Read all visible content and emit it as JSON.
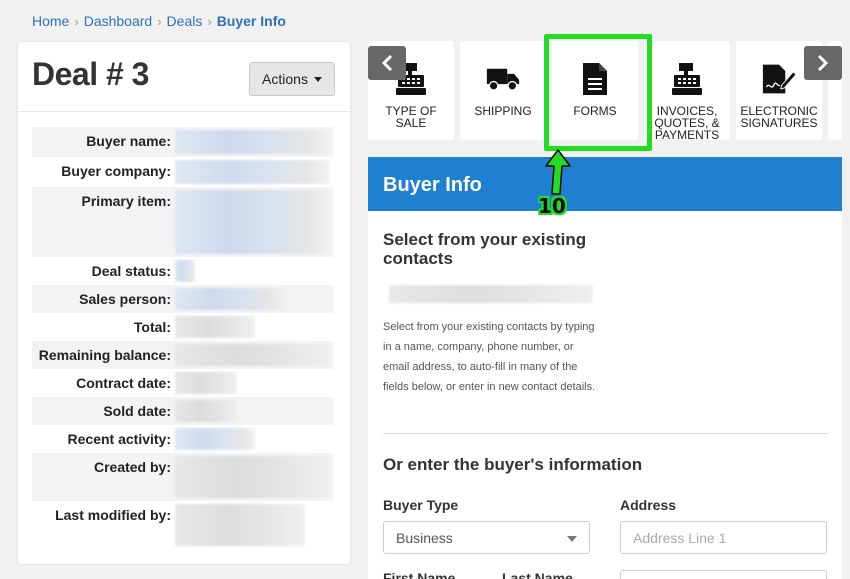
{
  "breadcrumb": {
    "home": "Home",
    "dashboard": "Dashboard",
    "deals": "Deals",
    "current": "Buyer Info",
    "separator": "›"
  },
  "deal": {
    "title": "Deal # 3",
    "actions_label": "Actions"
  },
  "deal_info": {
    "rows": [
      {
        "label": "Buyer name:"
      },
      {
        "label": "Buyer company:"
      },
      {
        "label": "Primary item:"
      },
      {
        "label": "Deal status:"
      },
      {
        "label": "Sales person:"
      },
      {
        "label": "Total:"
      },
      {
        "label": "Remaining balance:"
      },
      {
        "label": "Contract date:"
      },
      {
        "label": "Sold date:"
      },
      {
        "label": "Recent activity:"
      },
      {
        "label": "Created by:"
      },
      {
        "label": "Last modified by:"
      }
    ]
  },
  "tabs": [
    {
      "label": "TYPE OF SALE",
      "icon": "cash-register-icon"
    },
    {
      "label": "SHIPPING",
      "icon": "truck-icon"
    },
    {
      "label": "FORMS",
      "icon": "document-icon"
    },
    {
      "label": "INVOICES, QUOTES, & PAYMENTS",
      "icon": "cash-register-icon"
    },
    {
      "label": "ELECTRONIC SIGNATURES",
      "icon": "signature-icon"
    }
  ],
  "annotation": {
    "step_number": "10",
    "highlight_color": "#22dd22"
  },
  "buyer_panel": {
    "header": "Buyer Info",
    "existing_title": "Select from your existing contacts",
    "existing_help": "Select from your existing contacts by typing in a name, company, phone number, or email address, to auto-fill in many of the fields below, or enter in new contact details.",
    "enter_title": "Or enter the buyer's information",
    "buyer_type_label": "Buyer Type",
    "buyer_type_value": "Business",
    "address_label": "Address",
    "address_placeholder": "Address Line 1",
    "first_name_label": "First Name",
    "last_name_label": "Last Name"
  },
  "colors": {
    "link": "#2d72b8",
    "header_blue": "#1f7fd0",
    "nav_arrow": "#686868"
  }
}
